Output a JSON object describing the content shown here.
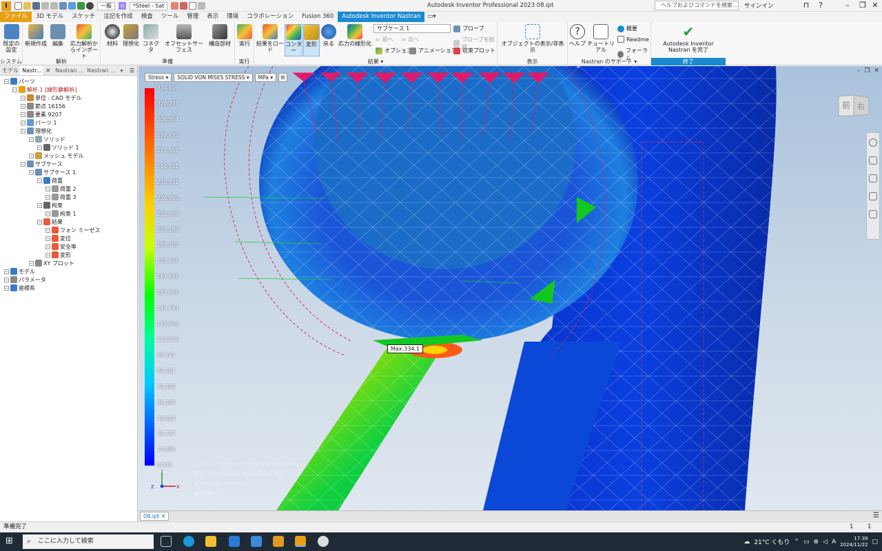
{
  "app": {
    "logo": "I",
    "window_title": "Autodesk Inventor Professional 2023   08.ipt",
    "qat_combo_general": "一般",
    "qat_combo_material": "*Steel - Sat",
    "help_search_placeholder": "ヘルプおよびコマンドを検索...",
    "signin": "サインイン"
  },
  "menu_tabs": [
    "ファイル",
    "3D モデル",
    "スケッチ",
    "注記を作成",
    "検査",
    "ツール",
    "管理",
    "表示",
    "環境",
    "コラボレーション",
    "Fusion 360",
    "Autodesk Inventor Nastran"
  ],
  "ribbon": {
    "groups": {
      "system": "システム",
      "analysis": "解析",
      "prepare": "準備",
      "run": "実行",
      "results": "結果",
      "display": "表示",
      "support": "Nastran のサポート",
      "finish": "終了"
    },
    "buttons": {
      "defaults": "既定の設定",
      "new": "新規作成",
      "edit": "編集",
      "import_stress": "応力解析からインポート",
      "material": "材料",
      "idealize": "理想化",
      "connector": "コネクタ",
      "offset_surface": "オフセットサーフェス",
      "structural_member": "構造部材",
      "run": "実行",
      "load_results": "結果をロード",
      "contour": "コンター",
      "deform": "変形",
      "back": "戻る",
      "stress_linearize": "応力の線形化",
      "show_hide": "オブジェクトの表示/非表示",
      "help": "ヘルプ",
      "tutorial": "チュートリアル",
      "overview": "概要",
      "readme": "Readme",
      "forum": "フォーラム",
      "finish": "Autodesk Inventor Nastran を完了"
    },
    "subcase_combo": "サブケース 1",
    "small": {
      "probe": "プローブ",
      "prev": "前へ",
      "next": "次へ",
      "remove_probe": "プローブを削除",
      "options": "オプション",
      "animation": "アニメーション",
      "convergence_plot": "収束プロット"
    }
  },
  "browser": {
    "tabs": [
      "モデル",
      "Nastr...",
      "Nastran ...",
      "Nastran ..."
    ],
    "tree": [
      {
        "label": "パーツ",
        "level": 0
      },
      {
        "label": "解析 1 [線形静解析]",
        "level": 1,
        "highlight": true
      },
      {
        "label": "単位 : CAD モデル",
        "level": 2
      },
      {
        "label": "節点 16156",
        "level": 2
      },
      {
        "label": "要素 9207",
        "level": 2
      },
      {
        "label": "パーツ 1",
        "level": 2
      },
      {
        "label": "理想化",
        "level": 2
      },
      {
        "label": "ソリッド",
        "level": 3
      },
      {
        "label": "ソリッド 1",
        "level": 4
      },
      {
        "label": "メッシュ モデル",
        "level": 3
      },
      {
        "label": "サブケース",
        "level": 2
      },
      {
        "label": "サブケース 1",
        "level": 3
      },
      {
        "label": "荷重",
        "level": 4
      },
      {
        "label": "荷重 2",
        "level": 5
      },
      {
        "label": "荷重 3",
        "level": 5
      },
      {
        "label": "拘束",
        "level": 4
      },
      {
        "label": "拘束 1",
        "level": 5
      },
      {
        "label": "結果",
        "level": 4
      },
      {
        "label": "フォン ミーゼス",
        "level": 5
      },
      {
        "label": "変位",
        "level": 5
      },
      {
        "label": "安全率",
        "level": 5
      },
      {
        "label": "変形",
        "level": 5
      },
      {
        "label": "XY プロット",
        "level": 3
      },
      {
        "label": "モデル",
        "level": 0
      },
      {
        "label": "パラメータ",
        "level": 0
      },
      {
        "label": "座標系",
        "level": 0
      }
    ]
  },
  "viewport": {
    "result_type": "Stress",
    "result_component": "SOLID VON MISES STRESS",
    "unit": "MPa",
    "legend_values": [
      "334.116",
      "320.235",
      "306.354",
      "292.473",
      "278.592",
      "264.711",
      "250.831",
      "236.950",
      "223.069",
      "209.188",
      "195.307",
      "181.426",
      "167.546",
      "153.665",
      "139.784",
      "125.903",
      "112.022",
      "98.141",
      "84.261",
      "70.380",
      "56.499",
      "42.618",
      "28.737",
      "14.856",
      "0.976"
    ],
    "max_label": "Max:334.1",
    "info_lines": [
      "コンター: SOLID VON MISES STRESS (MPa)",
      "変形: 合計 (MIN=0, MAX=0.651786)",
      "出力セット: サブケース 1",
      "解析: 解析 1"
    ],
    "viewcube_front": "前",
    "viewcube_right": "右"
  },
  "document_tab": "08.ipt",
  "status": {
    "text": "準備完了",
    "page_a": "1",
    "page_b": "1"
  },
  "taskbar": {
    "search_placeholder": "ここに入力して検索",
    "weather": "21°C くもり",
    "ime": "A",
    "time": "17:39",
    "date": "2024/11/22"
  },
  "colors": {
    "accent": "#1b8ad0",
    "file_tab": "#e8a013",
    "taskbar": "#1f2a36"
  }
}
